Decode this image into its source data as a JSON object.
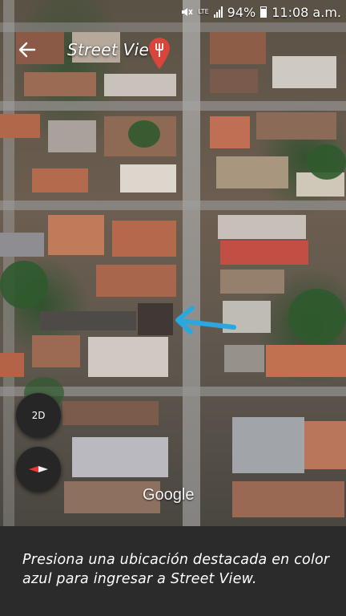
{
  "status_bar": {
    "mute_icon": "mute-icon",
    "network": "LTE",
    "battery": "94%",
    "time": "11:08 a.m."
  },
  "header": {
    "back_icon": "arrow-left-icon",
    "title": "Street View",
    "pin_icon": "map-pin-icon",
    "pin_color": "#d9453b"
  },
  "map": {
    "view_mode_button": "2D",
    "compass_icon": "compass-icon",
    "attribution": "Google",
    "highlight_color": "#29a8e0"
  },
  "instruction": "Presiona una ubicación destacada en color azul para ingresar a Street View."
}
